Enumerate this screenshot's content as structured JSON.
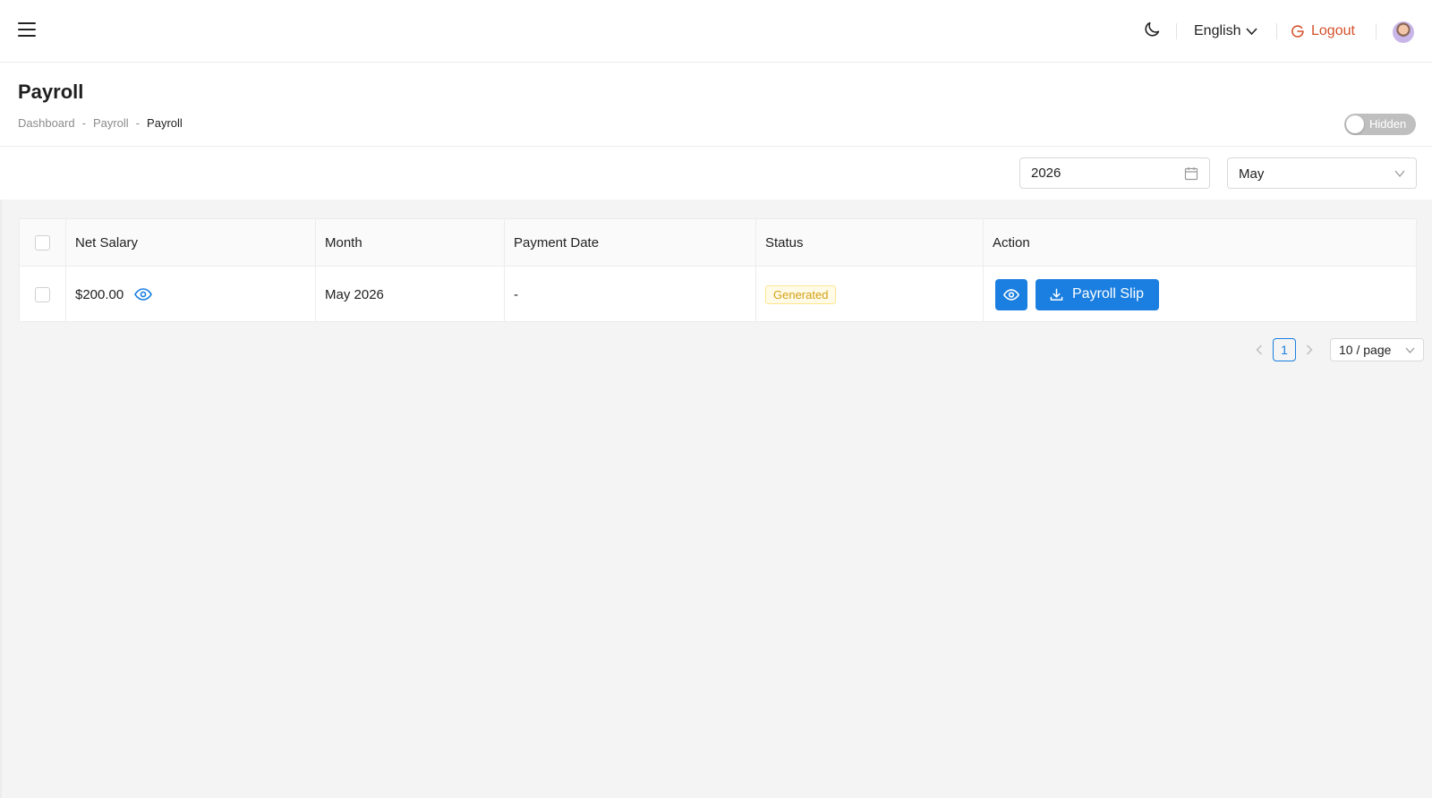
{
  "topbar": {
    "menu_icon": "hamburger-menu-icon",
    "theme_icon": "moon-icon",
    "language": "English",
    "logout_label": "Logout"
  },
  "header": {
    "title": "Payroll",
    "breadcrumb": [
      "Dashboard",
      "Payroll",
      "Payroll"
    ],
    "breadcrumb_separator": "-",
    "toggle_label": "Hidden"
  },
  "filters": {
    "year": "2026",
    "month": "May"
  },
  "table": {
    "columns": [
      "Net Salary",
      "Month",
      "Payment Date",
      "Status",
      "Action"
    ],
    "rows": [
      {
        "net_salary": "$200.00",
        "month": "May 2026",
        "payment_date": "-",
        "status": "Generated",
        "action_label": "Payroll Slip"
      }
    ]
  },
  "pagination": {
    "current_page": "1",
    "page_size": "10 / page"
  },
  "colors": {
    "primary": "#1a7fe0",
    "logout": "#d4512a",
    "status_warning_text": "#d4a017",
    "status_warning_bg": "#fffbe6"
  }
}
